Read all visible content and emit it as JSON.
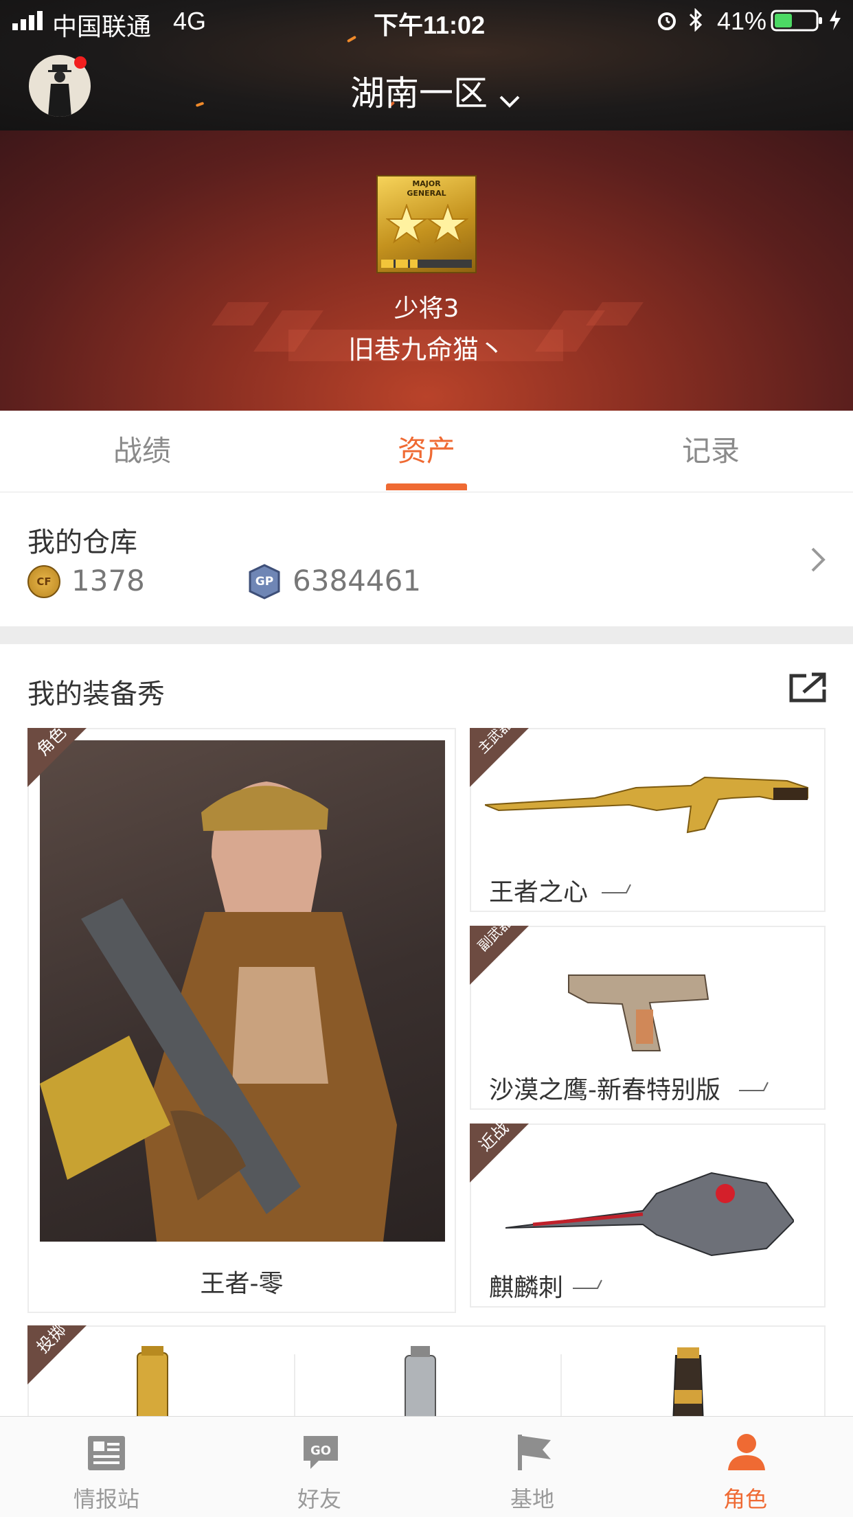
{
  "status_bar": {
    "carrier": "中国联通",
    "network": "4G",
    "time": "下午11:02",
    "battery": "41%"
  },
  "header": {
    "server_name": "湖南一区"
  },
  "profile": {
    "rank_badge_line1": "MAJOR",
    "rank_badge_line2": "GENERAL",
    "rank_name": "少将3",
    "player_name": "旧巷九命猫丶",
    "rank_progress": 0.4
  },
  "tabs": [
    {
      "label": "战绩"
    },
    {
      "label": "资产"
    },
    {
      "label": "记录"
    }
  ],
  "warehouse": {
    "title": "我的仓库",
    "cf_coin_icon_text": "CF",
    "cf_coins": "1378",
    "gp_icon_text": "GP",
    "gp_points": "6384461"
  },
  "equipment_show": {
    "title": "我的装备秀",
    "character": {
      "tag": "角色",
      "name": "王者-零"
    },
    "primary": {
      "tag": "主武器",
      "name": "王者之心"
    },
    "secondary": {
      "tag": "副武器",
      "name": "沙漠之鹰-新春特别版"
    },
    "melee": {
      "tag": "近战",
      "name": "麒麟刺"
    },
    "throwable": {
      "tag": "投掷"
    }
  },
  "bottom_nav": [
    {
      "label": "情报站"
    },
    {
      "label": "好友"
    },
    {
      "label": "基地"
    },
    {
      "label": "角色"
    }
  ],
  "colors": {
    "accent": "#ef6a33",
    "header_bg": "#1c1a1a",
    "banner_bg": "#8b2f22"
  }
}
